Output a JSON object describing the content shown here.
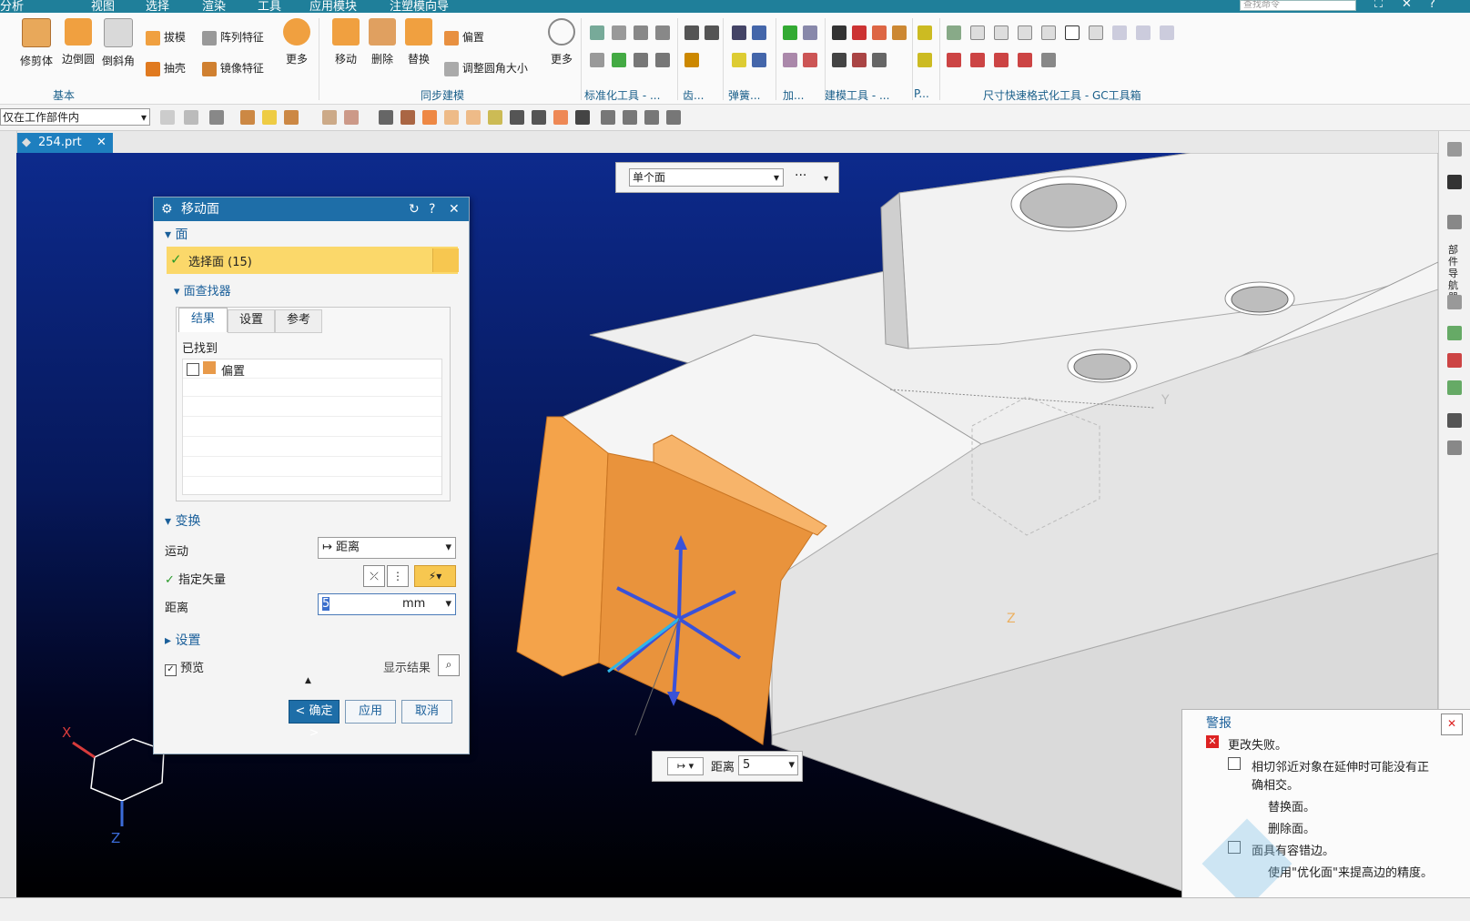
{
  "menu": {
    "items": [
      "分析",
      "视图",
      "选择",
      "渲染",
      "工具",
      "应用模块",
      "注塑模向导"
    ],
    "search_placeholder": "查找命令"
  },
  "ribbon": {
    "basic": {
      "labels": [
        "修剪体",
        "边倒圆",
        "倒斜角",
        "拔模",
        "阵列特征",
        "抽壳",
        "镜像特征",
        "更多"
      ],
      "group": "基本"
    },
    "sync": {
      "labels": [
        "移动",
        "删除",
        "替换",
        "偏置",
        "调整圆角大小",
        "更多"
      ],
      "group": "同步建模"
    },
    "groups": [
      "标准化工具 - ...",
      "齿...",
      "弹簧...",
      "加...",
      "建模工具 - ...",
      "P...",
      "尺寸快速格式化工具 - GC工具箱"
    ]
  },
  "toolbar": {
    "filter": "仅在工作部件内"
  },
  "tab": {
    "name": "254.prt"
  },
  "selection_bar": {
    "mode": "单个面",
    "more": "···"
  },
  "dialog": {
    "title": "移动面",
    "section_face": "面",
    "select_face": "选择面 (15)",
    "face_finder": "面查找器",
    "tabs": [
      "结果",
      "设置",
      "参考"
    ],
    "found_label": "已找到",
    "found_item": "偏置",
    "section_transform": "变换",
    "motion_label": "运动",
    "motion_value": "距离",
    "vector_label": "指定矢量",
    "distance_label": "距离",
    "distance_value": "5",
    "distance_unit": "mm",
    "section_settings": "设置",
    "preview_label": "预览",
    "show_result": "显示结果",
    "ok": "< 确定 >",
    "apply": "应用",
    "cancel": "取消"
  },
  "distance_float": {
    "label": "距离",
    "value": "5"
  },
  "axes": {
    "x": "X",
    "y": "Y",
    "z": "Z"
  },
  "alert": {
    "title": "警报",
    "error": "更改失败。",
    "reason1": "相切邻近对象在延伸时可能没有正",
    "reason2": "确相交。",
    "hint1": "替换面。",
    "hint2": "删除面。",
    "reason3": "面具有容错边。",
    "hint3": "使用\"优化面\"来提高边的精度。"
  },
  "side_panel": {
    "label": "部件导航器"
  },
  "colors": {
    "accent": "#1e6ea8",
    "selected_face": "#f5a24a",
    "model": "#e6e6e6"
  }
}
